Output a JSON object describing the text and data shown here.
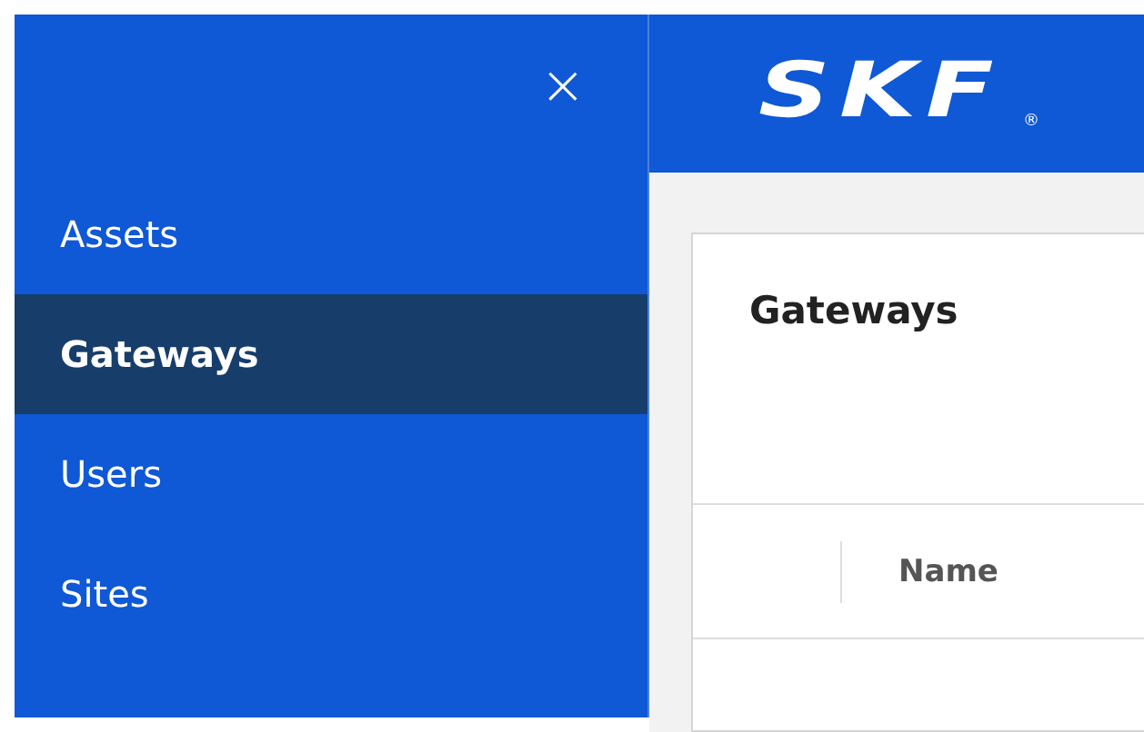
{
  "sidebar": {
    "close": "×",
    "items": [
      {
        "label": "Assets",
        "selected": false
      },
      {
        "label": "Gateways",
        "selected": true
      },
      {
        "label": "Users",
        "selected": false
      },
      {
        "label": "Sites",
        "selected": false
      }
    ]
  },
  "header": {
    "logo": "SKF",
    "logo_mark": "®"
  },
  "card": {
    "title": "Gateways",
    "columns": [
      "Name"
    ]
  }
}
